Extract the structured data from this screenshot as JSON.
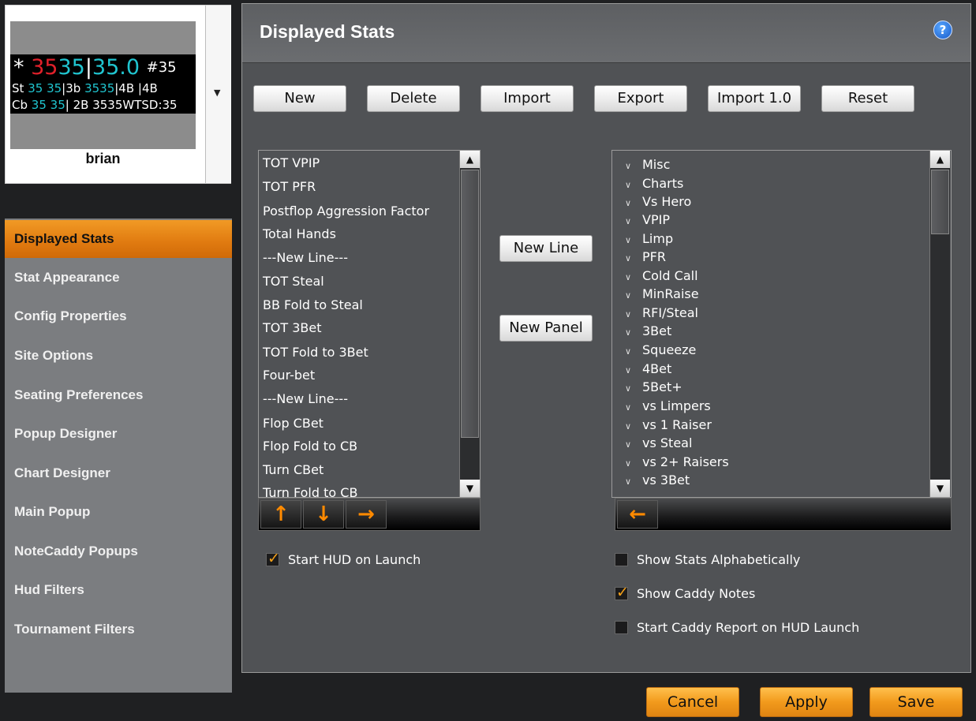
{
  "profile": {
    "player_name": "brian",
    "hud_preview": {
      "row1": [
        "*",
        "35",
        "35",
        "|",
        "35.0",
        "#35"
      ],
      "row2": [
        "St",
        "35",
        "35",
        "|3b",
        "35",
        "35",
        "|4B",
        "|4B"
      ],
      "row3": [
        "Cb",
        "35",
        "35",
        "| 2B",
        "3535",
        "WTSD:35"
      ]
    },
    "dropdown_icon": "triangle-down-icon"
  },
  "sidebar": {
    "items": [
      {
        "label": "Displayed Stats",
        "active": true
      },
      {
        "label": "Stat Appearance"
      },
      {
        "label": "Config Properties"
      },
      {
        "label": "Site Options"
      },
      {
        "label": "Seating Preferences"
      },
      {
        "label": "Popup Designer"
      },
      {
        "label": "Chart Designer"
      },
      {
        "label": "Main Popup"
      },
      {
        "label": "NoteCaddy Popups"
      },
      {
        "label": "Hud Filters"
      },
      {
        "label": "Tournament Filters"
      }
    ]
  },
  "panel": {
    "title": "Displayed Stats",
    "help_icon": "?",
    "toolbar_buttons": [
      "New",
      "Delete",
      "Import",
      "Export",
      "Import 1.0",
      "Reset"
    ],
    "new_line_button": "New Line",
    "new_panel_button": "New Panel"
  },
  "displayed_list": {
    "items": [
      "TOT VPIP",
      "TOT PFR",
      "Postflop Aggression Factor",
      "Total Hands",
      "---New Line---",
      "TOT Steal",
      "BB Fold to Steal",
      "TOT 3Bet",
      "TOT Fold to 3Bet",
      "Four-bet",
      "---New Line---",
      "Flop CBet",
      "Flop Fold to CB",
      "Turn CBet",
      "Turn Fold to CB"
    ]
  },
  "available_tree": {
    "items": [
      "Misc",
      "Charts",
      "Vs Hero",
      "VPIP",
      "Limp",
      "PFR",
      "Cold Call",
      "MinRaise",
      "RFI/Steal",
      "3Bet",
      "Squeeze",
      "4Bet",
      "5Bet+",
      "vs Limpers",
      "vs 1 Raiser",
      "vs Steal",
      "vs 2+ Raisers",
      "vs 3Bet"
    ]
  },
  "options": {
    "start_hud_on_launch": {
      "label": "Start HUD on Launch",
      "checked": true
    },
    "show_stats_alphabetically": {
      "label": "Show Stats Alphabetically",
      "checked": false
    },
    "show_caddy_notes": {
      "label": "Show Caddy Notes",
      "checked": true
    },
    "start_caddy_report": {
      "label": "Start Caddy Report on HUD Launch",
      "checked": false
    }
  },
  "footer": {
    "cancel": "Cancel",
    "apply": "Apply",
    "save": "Save"
  },
  "colors": {
    "accent": "#f29a1c",
    "panel_bg": "#505255",
    "sidebar_bg": "#7b7d80"
  }
}
